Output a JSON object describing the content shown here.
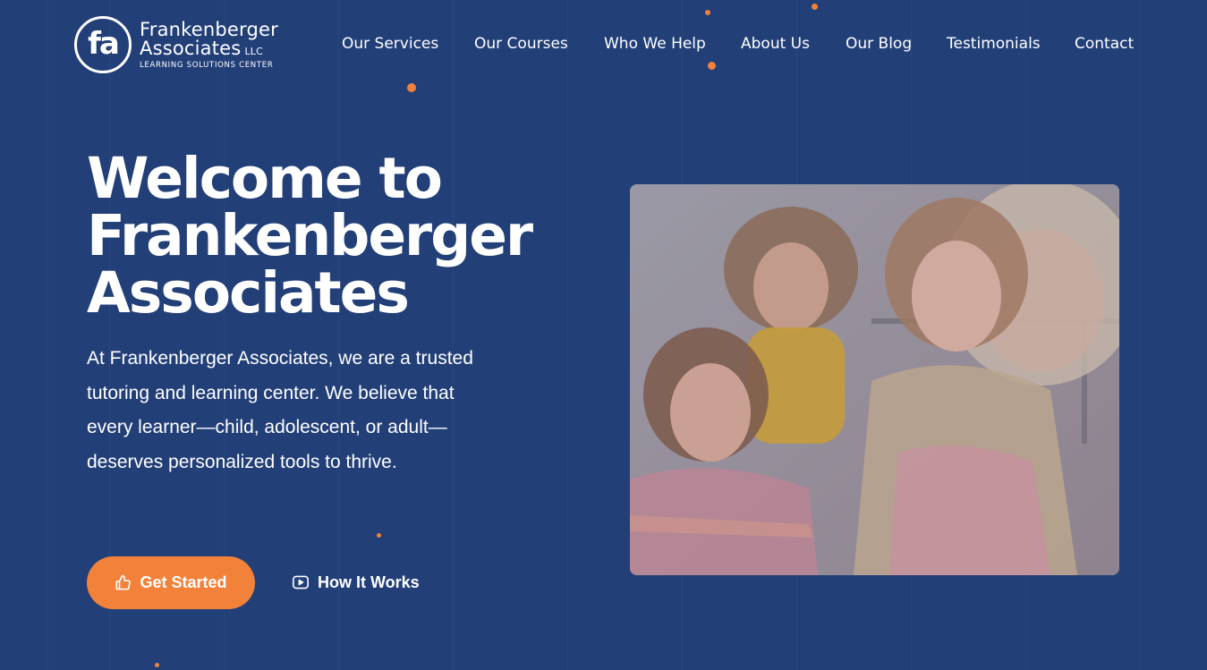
{
  "brand": {
    "mark": "fa",
    "name": "Frankenberger",
    "name2": "Associates",
    "llc": "LLC",
    "tagline": "LEARNING SOLUTIONS CENTER"
  },
  "nav": {
    "items": [
      {
        "label": "Our Services"
      },
      {
        "label": "Our Courses"
      },
      {
        "label": "Who We Help"
      },
      {
        "label": "About Us"
      },
      {
        "label": "Our Blog"
      },
      {
        "label": "Testimonials"
      },
      {
        "label": "Contact"
      }
    ]
  },
  "hero": {
    "title_line1": "Welcome to",
    "title_line2": "Frankenberger",
    "title_line3": "Associates",
    "description": "At Frankenberger Associates, we are a trusted tutoring and learning center. We believe that every learner—child, adolescent, or adult—deserves personalized tools to thrive.",
    "primary_button": "Get Started",
    "primary_icon": "thumbs-up-icon",
    "secondary_button": "How It Works",
    "secondary_icon": "play-icon",
    "image_icon": "children-photo"
  },
  "colors": {
    "background": "#223f78",
    "accent": "#f2813a",
    "text": "#ffffff"
  }
}
